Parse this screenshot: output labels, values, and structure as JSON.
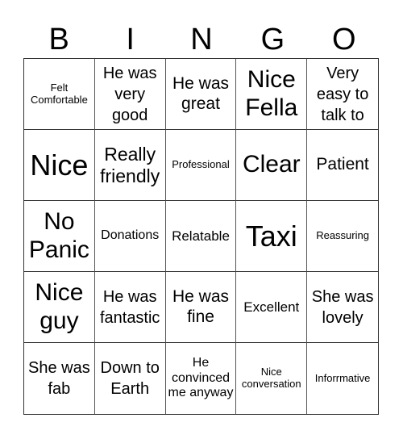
{
  "header": [
    "B",
    "I",
    "N",
    "G",
    "O"
  ],
  "cells": [
    "Felt Comfortable",
    "He was very good",
    "He was great",
    "Nice Fella",
    "Very easy to talk to",
    "Nice",
    "Really friendly",
    "Professional",
    "Clear",
    "Patient",
    "No Panic",
    "Donations",
    "Relatable",
    "Taxi",
    "Reassuring",
    "Nice guy",
    "He was fantastic",
    "He was fine",
    "Excellent",
    "She was lovely",
    "She was fab",
    "Down to Earth",
    "He convinced me anyway",
    "Nice conversation",
    "Inforrmative"
  ]
}
